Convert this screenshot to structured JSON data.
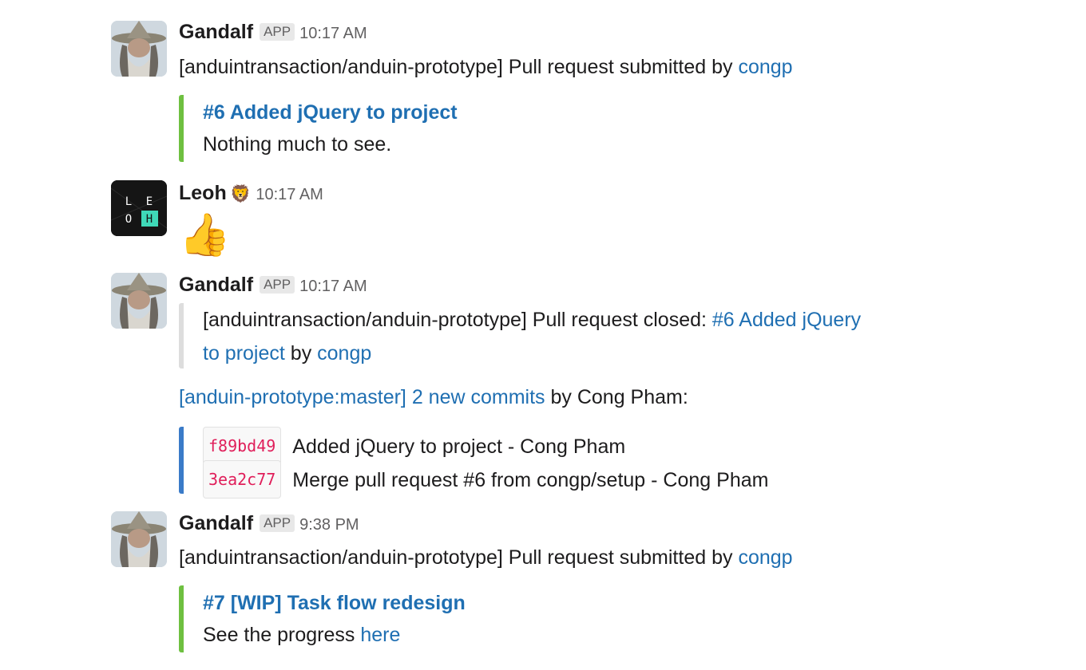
{
  "messages": [
    {
      "author": "Gandalf",
      "badge": "APP",
      "time": "10:17 AM",
      "text_prefix": "[anduintransaction/anduin-prototype] Pull request submitted by ",
      "text_link": "congp",
      "attachment": {
        "title": "#6 Added jQuery to project",
        "text": "Nothing much to see.",
        "border_color": "#6ec040"
      }
    },
    {
      "author": "Leoh",
      "author_emoji": "🦁",
      "time": "10:17 AM",
      "reaction_emoji": "👍",
      "avatar_letters": [
        "L",
        "E",
        "O",
        "H"
      ]
    },
    {
      "author": "Gandalf",
      "badge": "APP",
      "time": "10:17 AM",
      "closed_prefix": "[anduintransaction/anduin-prototype] Pull request closed: ",
      "closed_link_1": "#6 Added jQuery",
      "closed_link_2": "to project",
      "closed_by": " by ",
      "closed_user": "congp",
      "quote_border_color": "#dddddd",
      "commits_link": "[anduin-prototype:master] 2 new commits",
      "commits_suffix": " by Cong Pham:",
      "commit_border_color": "#3a7bc8",
      "commits": [
        {
          "sha": "f89bd49",
          "message": "Added jQuery to project - Cong Pham"
        },
        {
          "sha": "3ea2c77",
          "message": "Merge pull request #6 from congp/setup - Cong Pham"
        }
      ]
    },
    {
      "author": "Gandalf",
      "badge": "APP",
      "time": "9:38 PM",
      "text_prefix": "[anduintransaction/anduin-prototype] Pull request submitted by ",
      "text_link": "congp",
      "attachment": {
        "title": "#7 [WIP] Task flow redesign",
        "text_prefix": "See the progress ",
        "text_link": "here",
        "border_color": "#6ec040"
      }
    }
  ],
  "colors": {
    "link": "#1f6fb2",
    "sha": "#e01e5a",
    "timestamp": "#616061"
  }
}
